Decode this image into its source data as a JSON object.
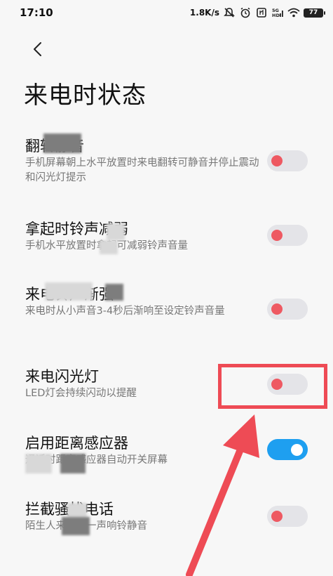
{
  "status_bar": {
    "time": "17:10",
    "network_speed": "1.8K/s",
    "battery_level": "77",
    "icons": [
      "mute-icon",
      "alarm-icon",
      "nfc-icon",
      "signal-5g-icon",
      "wifi-icon",
      "battery-icon"
    ]
  },
  "header": {
    "back_icon": "chevron-left-icon",
    "title": "来电时状态"
  },
  "settings": [
    {
      "title": "翻转静音",
      "description": "手机屏幕朝上水平放置时来电翻转可静音并停止震动和闪光灯提示",
      "enabled": false
    },
    {
      "title": "拿起时铃声减弱",
      "description": "手机水平放置时拿起可减弱铃声音量",
      "enabled": false
    },
    {
      "title": "来电铃声渐强",
      "description": "来电时从小声音3-4秒后渐响至设定铃声音量",
      "enabled": false
    },
    {
      "title": "来电闪光灯",
      "description": "LED灯会持续闪动以提醒",
      "enabled": false
    },
    {
      "title": "启用距离感应器",
      "description": "通话时距离感应器自动开关屏幕",
      "enabled": true
    },
    {
      "title": "拦截骚扰电话",
      "description": "陌生人来电第一声响铃静音",
      "enabled": false
    }
  ],
  "colors": {
    "toggle_off_track": "#e4e4e8",
    "toggle_off_knob": "#ee5962",
    "toggle_on_track": "#1e9ff0",
    "annotation_red": "#ee4b55"
  }
}
